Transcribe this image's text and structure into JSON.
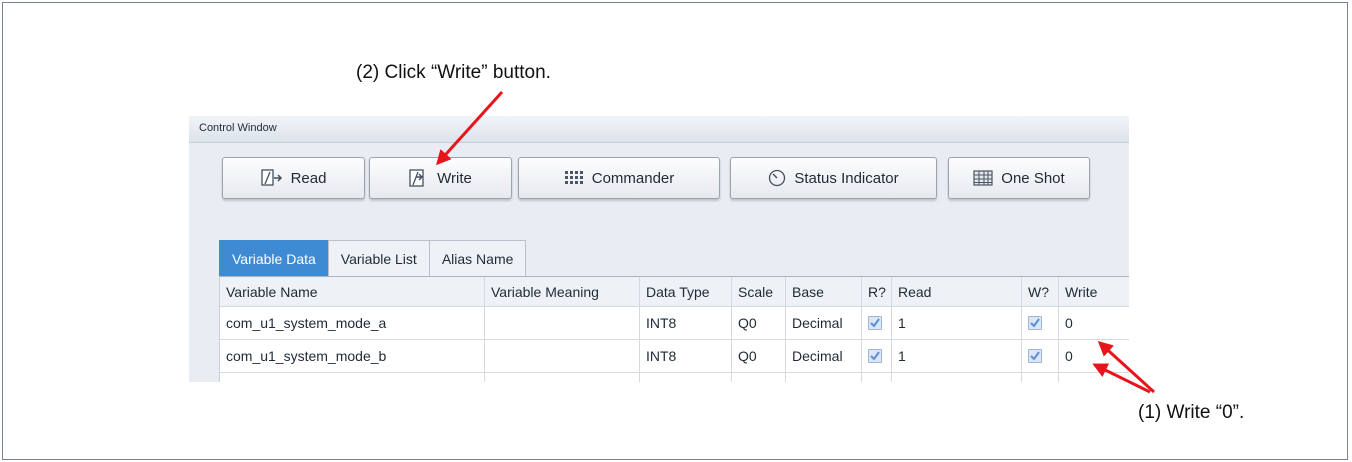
{
  "annotations": {
    "step2": "(2)  Click “Write” button.",
    "step1": "(1)  Write “0”."
  },
  "window": {
    "title": "Control Window"
  },
  "toolbar": {
    "read_label": "Read",
    "write_label": "Write",
    "commander_label": "Commander",
    "status_label": "Status Indicator",
    "oneshot_label": "One Shot"
  },
  "tabs": [
    {
      "label": "Variable Data",
      "active": true
    },
    {
      "label": "Variable List",
      "active": false
    },
    {
      "label": "Alias Name",
      "active": false
    }
  ],
  "table": {
    "columns": [
      "Variable Name",
      "Variable Meaning",
      "Data Type",
      "Scale",
      "Base",
      "R?",
      "Read",
      "W?",
      "Write"
    ],
    "rows": [
      {
        "name": "com_u1_system_mode_a",
        "meaning": "",
        "type": "INT8",
        "scale": "Q0",
        "base": "Decimal",
        "r": true,
        "read": "1",
        "w": true,
        "write": "0"
      },
      {
        "name": "com_u1_system_mode_b",
        "meaning": "",
        "type": "INT8",
        "scale": "Q0",
        "base": "Decimal",
        "r": true,
        "read": "1",
        "w": true,
        "write": "0"
      }
    ]
  },
  "colors": {
    "arrow": "#e8141b",
    "active_tab": "#3e8ad3",
    "checkbox": "#dbe7f6"
  },
  "icons": [
    "read-icon",
    "write-icon",
    "commander-icon",
    "status-indicator-icon",
    "one-shot-icon",
    "checkbox-icon"
  ]
}
